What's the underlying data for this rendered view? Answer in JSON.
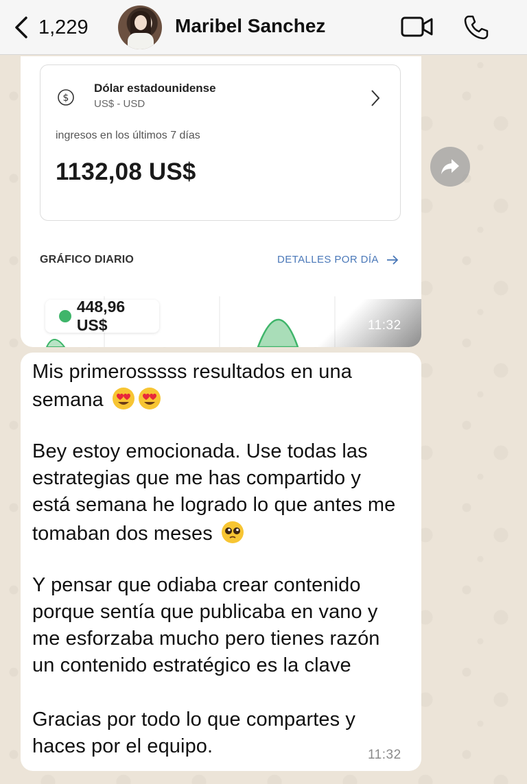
{
  "header": {
    "back_count": "1,229",
    "contact_name": "Maribel Sanchez"
  },
  "image_message": {
    "currency_name": "Dólar estadounidense",
    "currency_code": "US$ - USD",
    "income_label": "ingresos en los últimos 7 días",
    "income_value": "1132,08 US$",
    "chart_title": "GRÁFICO DIARIO",
    "details_link": "DETALLES POR DÍA",
    "tooltip_value": "448,96 US$",
    "time": "11:32"
  },
  "text_message": {
    "lines": [
      "Mis primerosssss resultados en una",
      "semana",
      "Bey estoy emocionada. Use todas las",
      "estrategias que me has compartido y",
      "está semana he logrado lo que antes me",
      "tomaban dos meses",
      "Y pensar que odiaba crear contenido",
      "porque sentía que publicaba en vano y",
      "me esforzaba mucho pero tienes razón",
      "un contenido estratégico es la clave",
      "Gracias por todo lo que compartes y",
      "haces por el equipo."
    ],
    "time": "11:32"
  },
  "colors": {
    "header_bg": "#f6f6f6",
    "wallpaper": "#ece4d8",
    "bubble": "#ffffff",
    "chart_green": "#3fb56a",
    "link_blue": "#4a78b8"
  },
  "icons": [
    "chevron-left-icon",
    "video-call-icon",
    "phone-icon",
    "forward-icon",
    "dollar-icon",
    "chevron-right-icon",
    "arrow-right-icon",
    "heart-eyes-emoji",
    "pleading-face-emoji"
  ]
}
